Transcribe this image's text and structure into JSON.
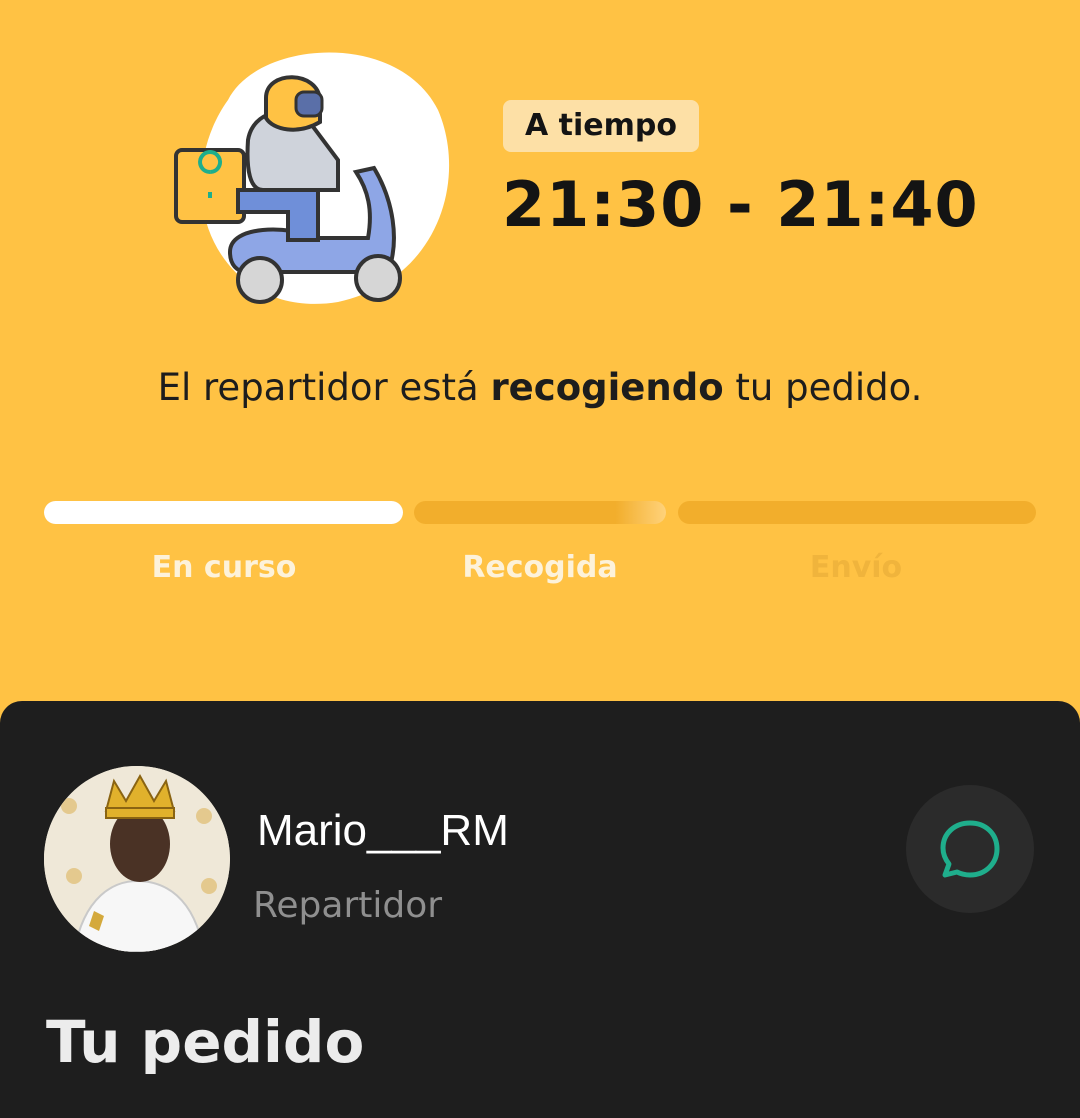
{
  "status": {
    "eta_badge": "A tiempo",
    "eta_range": "21:30 - 21:40",
    "message_prefix": "El repartidor está",
    "message_bold": "recogiendo",
    "message_suffix": "tu pedido."
  },
  "progress_steps": [
    {
      "label": "En curso",
      "fill": 1.0
    },
    {
      "label": "Recogida",
      "fill": 0.0
    },
    {
      "label": "Envío",
      "fill": 0.0
    }
  ],
  "courier": {
    "name": "Mario___RM",
    "role": "Repartidor"
  },
  "order_section": {
    "title": "Tu pedido"
  },
  "icons": {
    "illustration": "delivery-scooter-icon",
    "chat": "chat-bubble-icon",
    "avatar": "avatar"
  },
  "colors": {
    "background": "#FFC244",
    "badge": "#FDE0A6",
    "sheet": "#1E1E1E",
    "chat_icon": "#1FAE8C"
  }
}
